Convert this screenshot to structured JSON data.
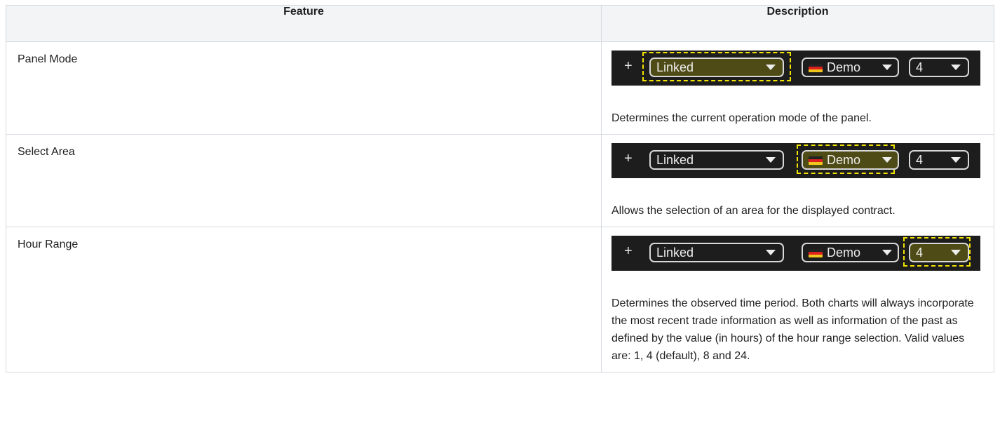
{
  "headers": {
    "feature": "Feature",
    "description": "Description"
  },
  "toolbar": {
    "plus": "+",
    "mode": "Linked",
    "area": "Demo",
    "hours": "4"
  },
  "rows": [
    {
      "feature": "Panel Mode",
      "highlight": "mode",
      "description": "Determines the current operation mode of the panel."
    },
    {
      "feature": "Select Area",
      "highlight": "area",
      "description": "Allows the selection of an area for the displayed contract."
    },
    {
      "feature": "Hour Range",
      "highlight": "hours",
      "description": "Determines the observed time period. Both charts will always incorporate the most recent trade information as well as information of the past as defined by the value (in hours) of the hour range selection. Valid values are: 1, 4 (default), 8 and 24."
    }
  ],
  "colors": {
    "toolbar_bg": "#1d1d1d",
    "highlight_dash": "#f2e200",
    "highlight_fill": "#4f4b16"
  }
}
